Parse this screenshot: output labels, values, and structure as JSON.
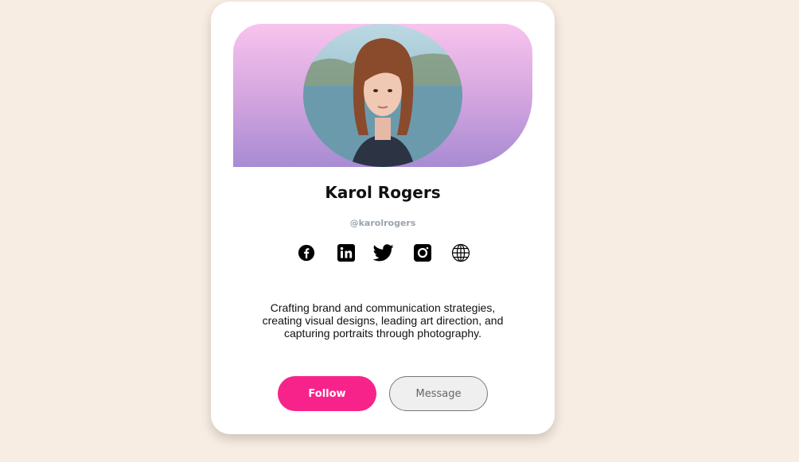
{
  "profile": {
    "name": "Karol Rogers",
    "handle": "@karolrogers",
    "bio": "Crafting brand and communication strategies, creating visual designs, leading art direction, and capturing portraits through photography."
  },
  "socials": [
    {
      "icon": "facebook-icon"
    },
    {
      "icon": "linkedin-icon"
    },
    {
      "icon": "twitter-icon"
    },
    {
      "icon": "instagram-icon"
    },
    {
      "icon": "globe-icon"
    }
  ],
  "actions": {
    "follow_label": "Follow",
    "message_label": "Message"
  },
  "colors": {
    "background": "#f7ede3",
    "accent": "#f7238a",
    "banner_top": "#f8c4ee",
    "banner_bottom": "#a88bd2"
  }
}
